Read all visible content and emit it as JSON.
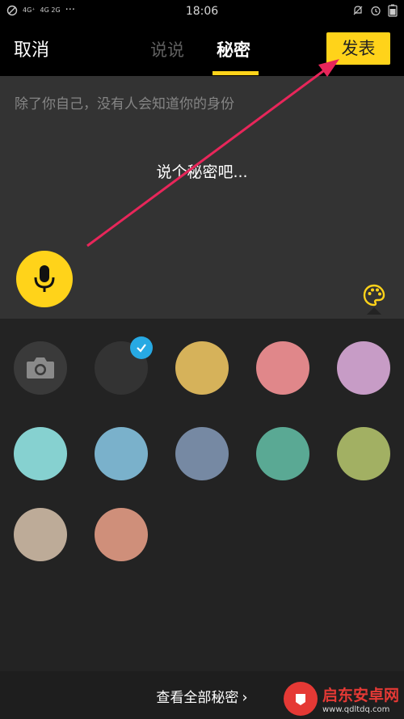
{
  "status_bar": {
    "network_1": "4G⁺",
    "network_2": "4G 2G",
    "dots": "···",
    "time": "18:06",
    "icons": [
      "no-disturb-icon",
      "alarm-icon",
      "battery-icon"
    ]
  },
  "header": {
    "cancel": "取消",
    "tabs": [
      {
        "label": "说说",
        "active": false
      },
      {
        "label": "秘密",
        "active": true
      }
    ],
    "publish": "发表"
  },
  "compose": {
    "hint": "除了你自己，没有人会知道你的身份",
    "placeholder": "说个秘密吧..."
  },
  "swatches": {
    "selected_index": 1,
    "items": [
      {
        "kind": "camera",
        "color": "#3a3a3a"
      },
      {
        "kind": "color",
        "color": "#333333"
      },
      {
        "kind": "color",
        "color": "#d6b25a"
      },
      {
        "kind": "color",
        "color": "#e0878a"
      },
      {
        "kind": "color",
        "color": "#c79cc6"
      },
      {
        "kind": "color",
        "color": "#86d1d0"
      },
      {
        "kind": "color",
        "color": "#7ab1cb"
      },
      {
        "kind": "color",
        "color": "#7689a3"
      },
      {
        "kind": "color",
        "color": "#5aa994"
      },
      {
        "kind": "color",
        "color": "#a2b063"
      },
      {
        "kind": "color",
        "color": "#bdab98"
      },
      {
        "kind": "color",
        "color": "#cf8f7a"
      }
    ]
  },
  "footer": {
    "view_all": "查看全部秘密"
  },
  "watermark": {
    "line1": "启东安卓网",
    "line2": "www.qdltdq.com"
  },
  "accent": "#ffd31a"
}
